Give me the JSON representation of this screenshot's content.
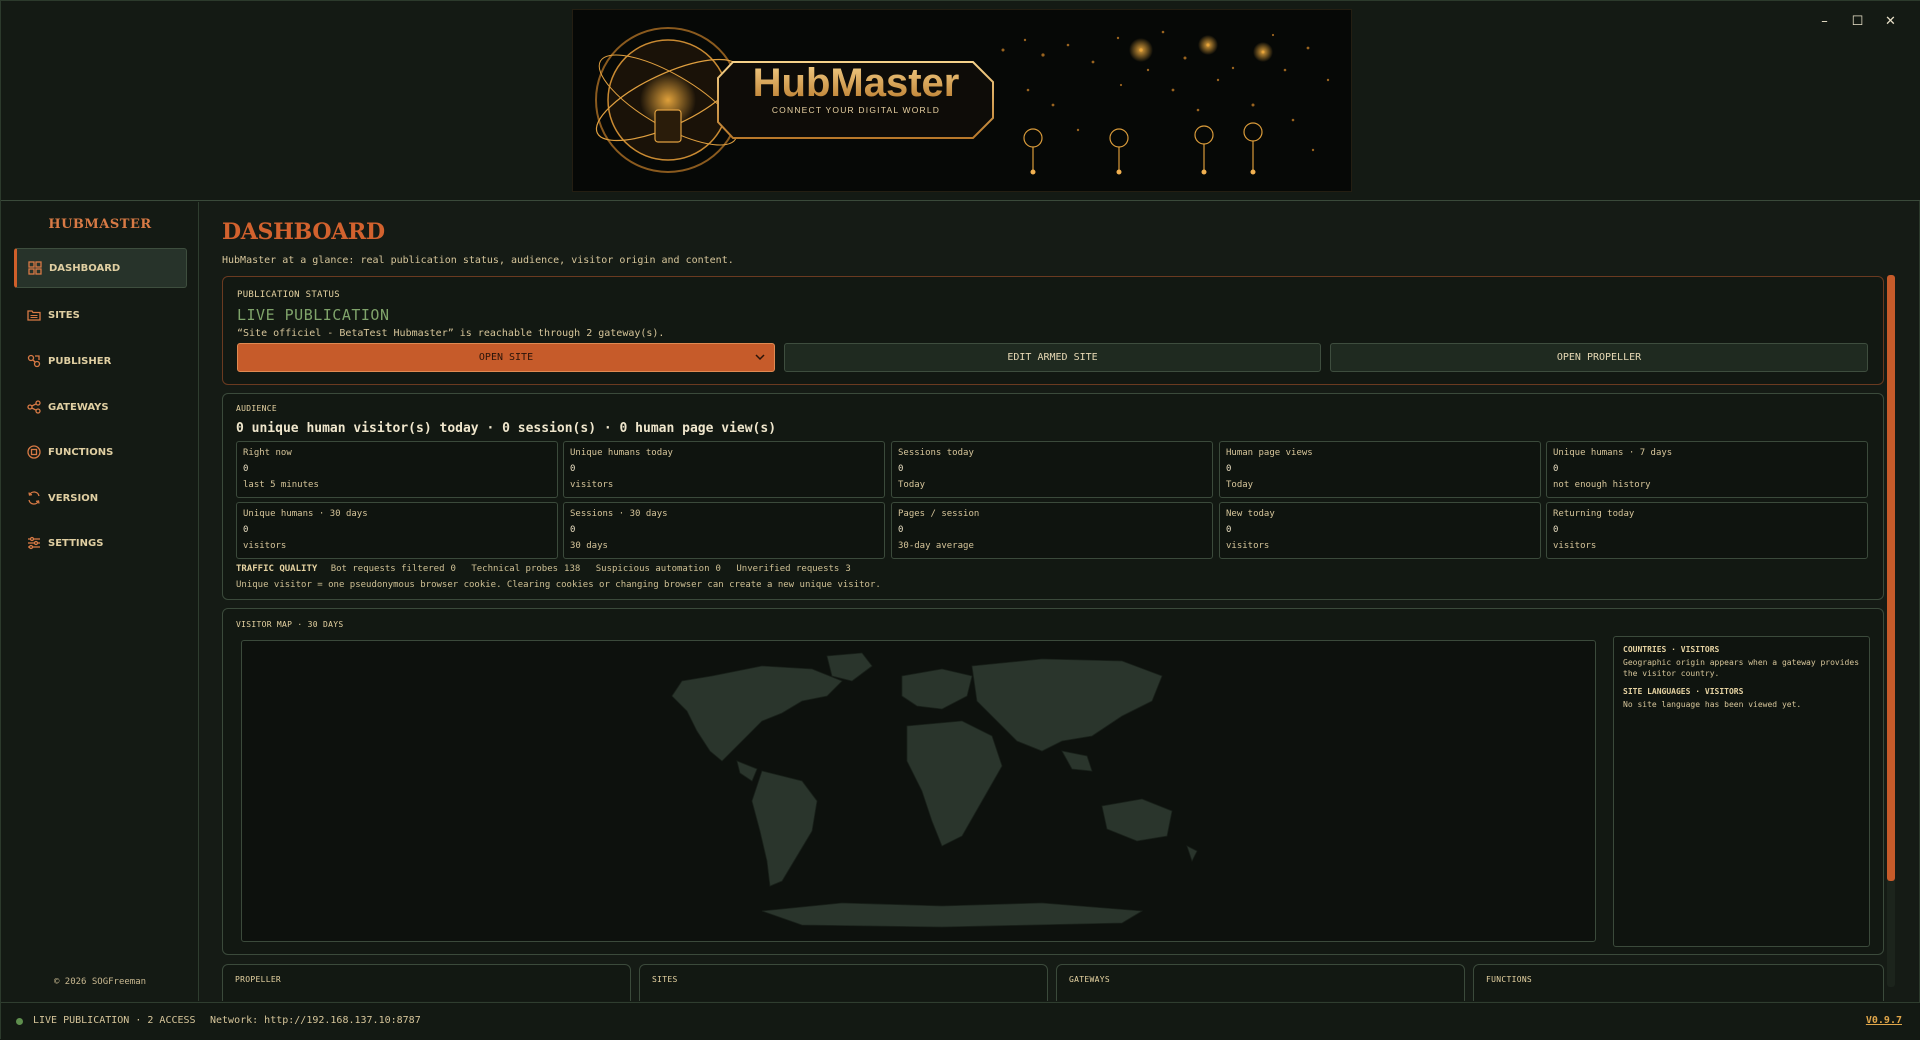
{
  "window": {
    "controls": {
      "minimize": "–",
      "maximize": "☐",
      "close": "✕"
    }
  },
  "banner": {
    "logo_text": "HubMaster",
    "tagline": "CONNECT YOUR DIGITAL WORLD"
  },
  "sidebar": {
    "brand": "HUBMASTER",
    "items": [
      {
        "label": "DASHBOARD",
        "icon": "grid-icon",
        "active": true
      },
      {
        "label": "SITES",
        "icon": "folder-icon",
        "active": false
      },
      {
        "label": "PUBLISHER",
        "icon": "share-nodes-icon",
        "active": false
      },
      {
        "label": "GATEWAYS",
        "icon": "network-icon",
        "active": false
      },
      {
        "label": "FUNCTIONS",
        "icon": "chip-icon",
        "active": false
      },
      {
        "label": "VERSION",
        "icon": "refresh-icon",
        "active": false
      },
      {
        "label": "SETTINGS",
        "icon": "sliders-icon",
        "active": false
      }
    ],
    "copyright": "© 2026 SOGFreeman"
  },
  "main": {
    "title": "DASHBOARD",
    "subtitle": "HubMaster at a glance: real publication status, audience, visitor origin and content.",
    "publication": {
      "label": "PUBLICATION STATUS",
      "status": "LIVE PUBLICATION",
      "description": "“Site officiel - BetaTest Hubmaster” is reachable through 2 gateway(s).",
      "buttons": {
        "open_site": "OPEN SITE",
        "edit_armed": "EDIT ARMED SITE",
        "open_propeller": "OPEN PROPELLER"
      }
    },
    "audience": {
      "label": "AUDIENCE",
      "headline": "0 unique human visitor(s) today · 0 session(s) · 0 human page view(s)",
      "stats": [
        {
          "label": "Right now",
          "value": "0",
          "sub": "last 5 minutes"
        },
        {
          "label": "Unique humans today",
          "value": "0",
          "sub": "visitors"
        },
        {
          "label": "Sessions today",
          "value": "0",
          "sub": "Today"
        },
        {
          "label": "Human page views",
          "value": "0",
          "sub": "Today"
        },
        {
          "label": "Unique humans · 7 days",
          "value": "0",
          "sub": "not enough history"
        },
        {
          "label": "Unique humans · 30 days",
          "value": "0",
          "sub": "visitors"
        },
        {
          "label": "Sessions · 30 days",
          "value": "0",
          "sub": "30 days"
        },
        {
          "label": "Pages / session",
          "value": "0",
          "sub": "30-day average"
        },
        {
          "label": "New today",
          "value": "0",
          "sub": "visitors"
        },
        {
          "label": "Returning today",
          "value": "0",
          "sub": "visitors"
        }
      ],
      "traffic_quality": {
        "label": "TRAFFIC QUALITY",
        "bot_label": "Bot requests filtered",
        "bot_value": "0",
        "probes_label": "Technical probes",
        "probes_value": "138",
        "auto_label": "Suspicious automation",
        "auto_value": "0",
        "unverified_label": "Unverified requests",
        "unverified_value": "3"
      },
      "note": "Unique visitor = one pseudonymous browser cookie. Clearing cookies or changing browser can create a new unique visitor."
    },
    "visitor_map": {
      "label": "VISITOR MAP · 30 DAYS",
      "countries_title": "COUNTRIES · VISITORS",
      "countries_text": "Geographic origin appears when a gateway provides the visitor country.",
      "languages_title": "SITE LANGUAGES · VISITORS",
      "languages_text": "No site language has been viewed yet."
    },
    "bottom_cards": [
      "PROPELLER",
      "SITES",
      "GATEWAYS",
      "FUNCTIONS"
    ]
  },
  "statusbar": {
    "status": "LIVE PUBLICATION · 2 ACCESS",
    "network": "Network: http://192.168.137.10:8787",
    "version": "V0.9.7"
  },
  "colors": {
    "accent": "#c65b2a",
    "live_green": "#7fa36a",
    "background": "#141a14",
    "text": "#d9c9a0"
  }
}
